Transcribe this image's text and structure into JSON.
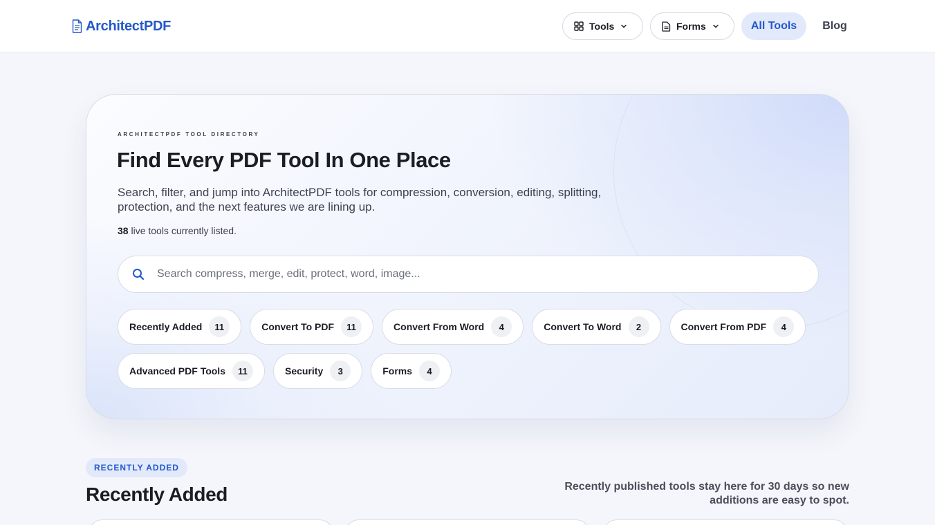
{
  "header": {
    "logo_text": "ArchitectPDF",
    "nav": {
      "tools_label": "Tools",
      "forms_label": "Forms",
      "all_tools_label": "All Tools",
      "blog_label": "Blog"
    }
  },
  "hero": {
    "eyebrow": "ARCHITECTPDF TOOL DIRECTORY",
    "title": "Find Every PDF Tool In One Place",
    "description": "Search, filter, and jump into ArchitectPDF tools for compression, conversion, editing, splitting, protection, and the next features we are lining up.",
    "count_number": "38",
    "count_suffix": " live tools currently listed.",
    "search_placeholder": "Search compress, merge, edit, protect, word, image...",
    "chips": [
      {
        "label": "Recently Added",
        "count": "11"
      },
      {
        "label": "Convert To PDF",
        "count": "11"
      },
      {
        "label": "Convert From Word",
        "count": "4"
      },
      {
        "label": "Convert To Word",
        "count": "2"
      },
      {
        "label": "Convert From PDF",
        "count": "4"
      },
      {
        "label": "Advanced PDF Tools",
        "count": "11"
      },
      {
        "label": "Security",
        "count": "3"
      },
      {
        "label": "Forms",
        "count": "4"
      }
    ]
  },
  "section": {
    "tag": "RECENTLY ADDED",
    "title": "Recently Added",
    "note": "Recently published tools stay here for 30 days so new additions are easy to spot."
  },
  "colors": {
    "accent": "#2358c9",
    "accent_soft": "#e1e9fb",
    "background": "#f5f6fb"
  }
}
